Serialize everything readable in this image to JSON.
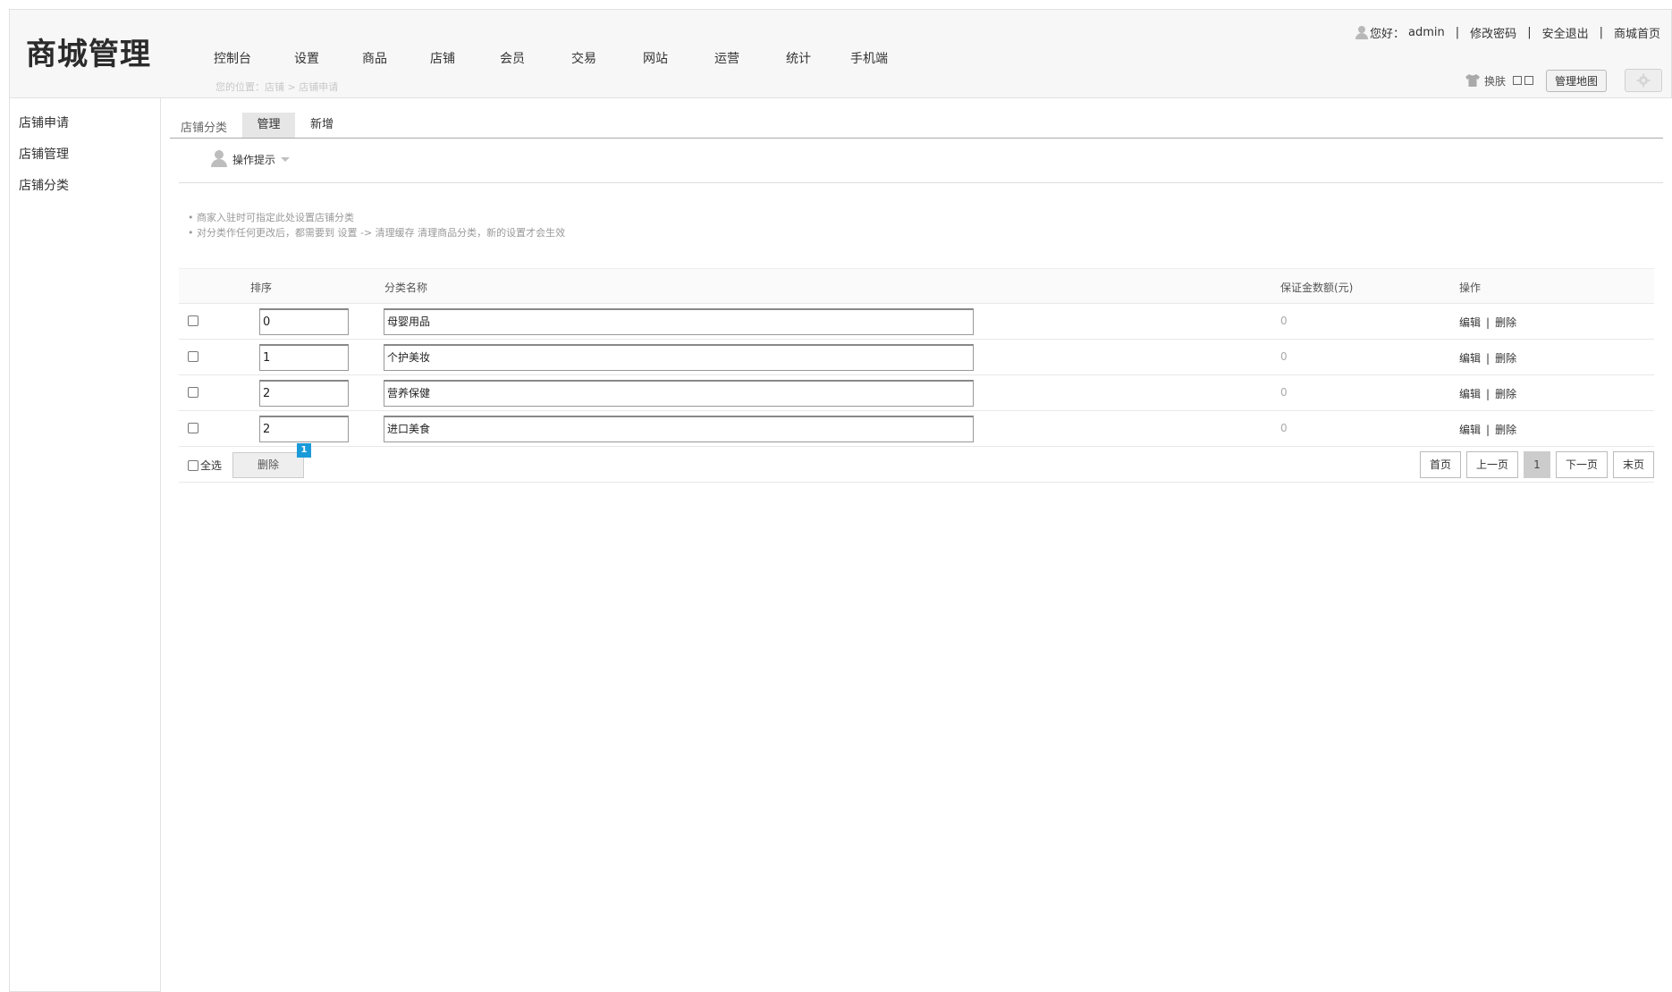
{
  "header": {
    "logo": "商城管理",
    "nav": [
      "控制台",
      "设置",
      "商品",
      "店铺",
      "会员",
      "交易",
      "网站",
      "运营",
      "统计",
      "手机端"
    ],
    "breadcrumb": "您的位置：店铺 > 店铺申请",
    "greeting": "您好：",
    "username": "admin",
    "change_password": "修改密码",
    "logout": "安全退出",
    "mall_home": "商城首页",
    "skin_label": "换肤",
    "map_button": "管理地图"
  },
  "sidebar": {
    "items": [
      "店铺申请",
      "店铺管理",
      "店铺分类"
    ]
  },
  "main": {
    "tab_title": "店铺分类",
    "tabs": [
      "管理",
      "新增"
    ],
    "tips_toggle": "操作提示",
    "tips": [
      "• 商家入驻时可指定此处设置店铺分类",
      "• 对分类作任何更改后，都需要到 设置 -> 清理缓存 清理商品分类，新的设置才会生效"
    ]
  },
  "table": {
    "headers": [
      "排序",
      "分类名称",
      "保证金数额(元)",
      "操作"
    ],
    "rows": [
      {
        "sort": "0",
        "name": "母婴用品",
        "deposit": "0",
        "edit": "编辑",
        "delete": "删除"
      },
      {
        "sort": "1",
        "name": "个护美妆",
        "deposit": "0",
        "edit": "编辑",
        "delete": "删除"
      },
      {
        "sort": "2",
        "name": "营养保健",
        "deposit": "0",
        "edit": "编辑",
        "delete": "删除"
      },
      {
        "sort": "2",
        "name": "进口美食",
        "deposit": "0",
        "edit": "编辑",
        "delete": "删除"
      }
    ],
    "select_all": "全选",
    "delete_button": "删除",
    "delete_badge": "1"
  },
  "pager": {
    "first": "首页",
    "prev": "上一页",
    "current": "1",
    "next": "下一页",
    "last": "末页"
  },
  "colors": {
    "badge": "#1a9ad9",
    "active_tab": "#e6e6e6",
    "header_bg": "#f7f7f7"
  }
}
